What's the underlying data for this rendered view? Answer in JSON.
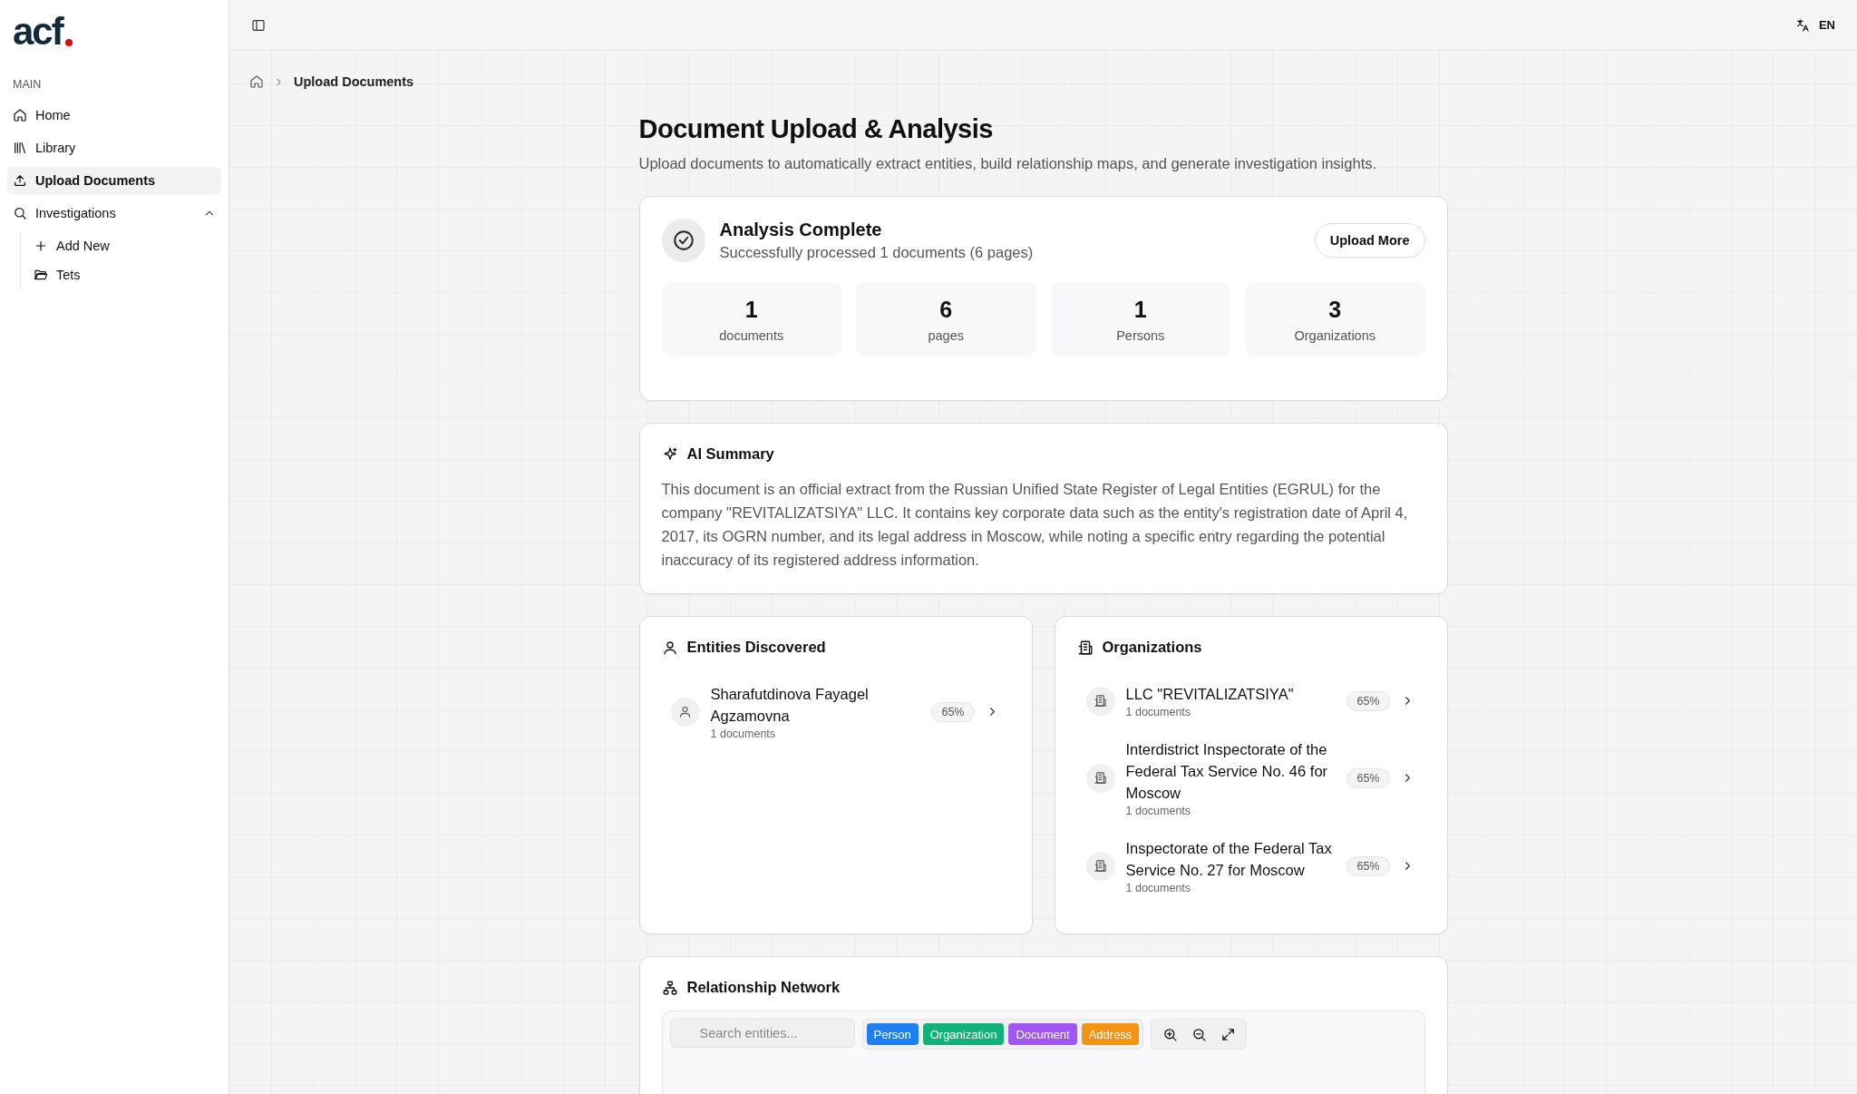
{
  "sidebar": {
    "logo": "acf",
    "section_label": "MAIN",
    "items": [
      {
        "kind": "link",
        "label": "Home",
        "selected": false
      },
      {
        "kind": "link",
        "label": "Library",
        "selected": false
      },
      {
        "kind": "link",
        "label": "Upload Documents",
        "selected": true
      },
      {
        "kind": "group",
        "label": "Investigations",
        "selected": false,
        "expanded": true,
        "children": [
          {
            "label": "Add New",
            "selected": false
          },
          {
            "label": "Tets",
            "selected": false
          }
        ]
      }
    ]
  },
  "topbar": {
    "language": "EN"
  },
  "breadcrumb": [
    "Upload Documents"
  ],
  "page": {
    "title": "Document Upload & Analysis",
    "subtitle": "Upload documents to automatically extract entities, build relationship maps, and generate investigation insights."
  },
  "status_card": {
    "title": "Analysis Complete",
    "message": "Successfully processed 1 documents (6 pages)",
    "button": "Upload More",
    "stats": [
      {
        "value": "1",
        "label": "documents"
      },
      {
        "value": "6",
        "label": "pages"
      },
      {
        "value": "1",
        "label": "Persons"
      },
      {
        "value": "3",
        "label": "Organizations"
      }
    ]
  },
  "ai_summary": {
    "title": "AI Summary",
    "text": "This document is an official extract from the Russian Unified State Register of Legal Entities (EGRUL) for the company \"REVITALIZATSIYA\" LLC. It contains key corporate data such as the entity's registration date of April 4, 2017, its OGRN number, and its legal address in Moscow, while noting a specific entry regarding the potential inaccuracy of its registered address information."
  },
  "entities": {
    "title": "Entities Discovered",
    "items": [
      {
        "name": "Sharafutdinova Fayagel Agzamovna",
        "documents": "1 documents",
        "confidence": "65%"
      }
    ]
  },
  "organizations": {
    "title": "Organizations",
    "items": [
      {
        "name": "LLC \"REVITALIZATSIYA\"",
        "documents": "1 documents",
        "confidence": "65%"
      },
      {
        "name": "Interdistrict Inspectorate of the Federal Tax Service No. 46 for Moscow",
        "documents": "1 documents",
        "confidence": "65%"
      },
      {
        "name": "Inspectorate of the Federal Tax Service No. 27 for Moscow",
        "documents": "1 documents",
        "confidence": "65%"
      }
    ]
  },
  "network": {
    "title": "Relationship Network",
    "search": {
      "placeholder": "Search entities..."
    },
    "filters": [
      {
        "label": "Person",
        "color": "#1e80f0"
      },
      {
        "label": "Organization",
        "color": "#10b27a"
      },
      {
        "label": "Document",
        "color": "#a155f2"
      },
      {
        "label": "Address",
        "color": "#f59312"
      }
    ]
  }
}
